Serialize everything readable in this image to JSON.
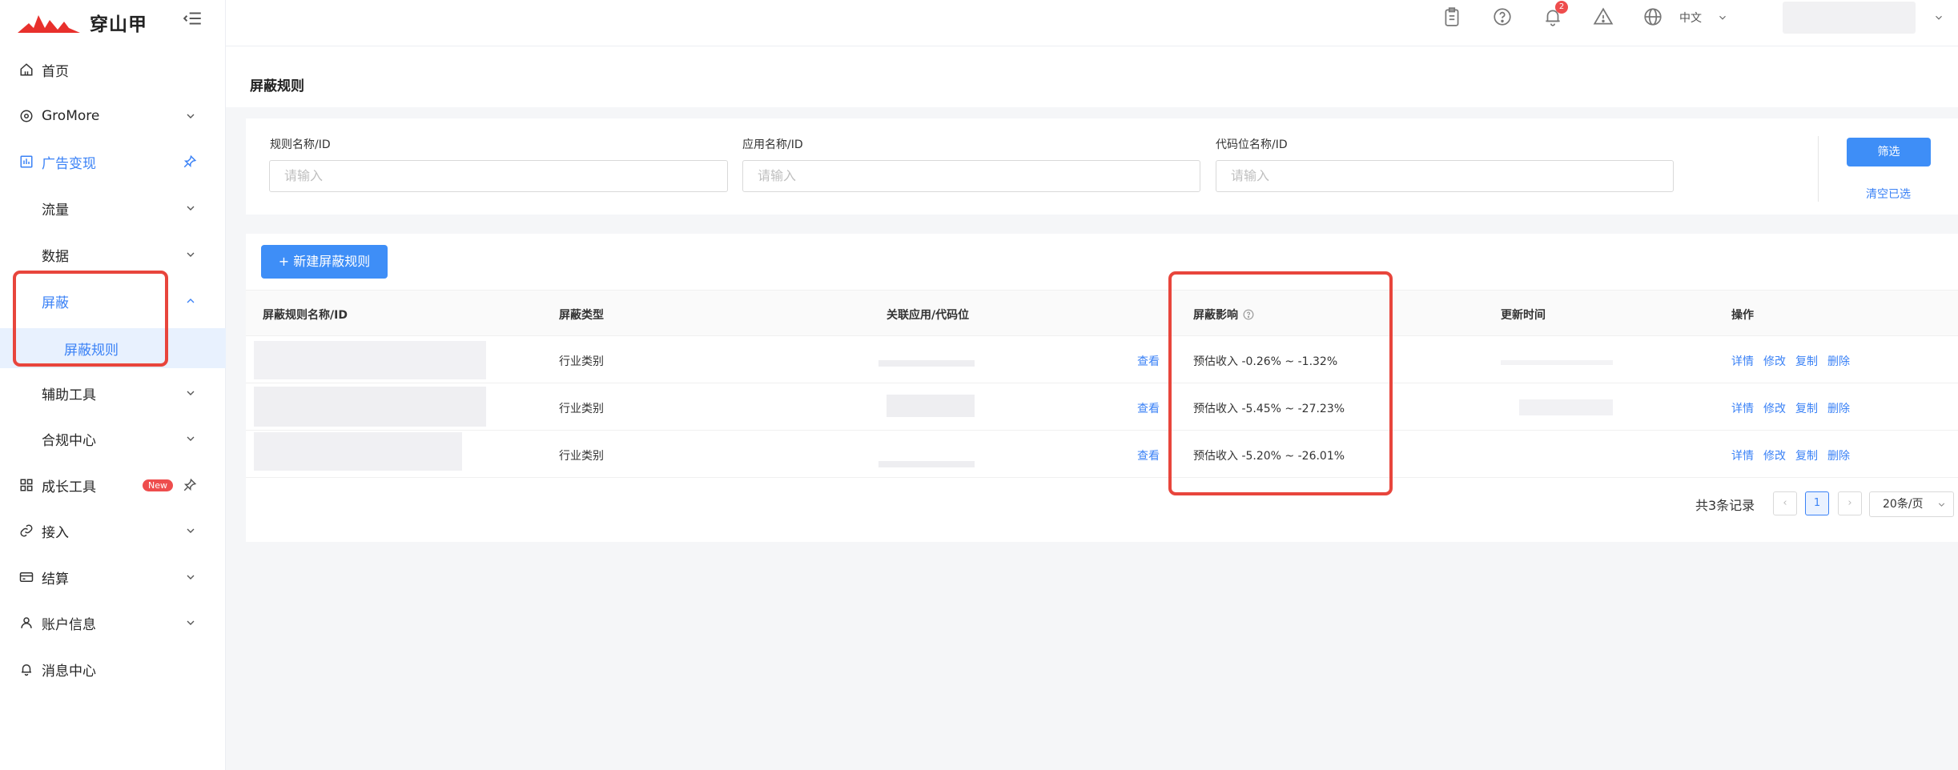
{
  "app": {
    "logo_text": "穿山甲"
  },
  "sidebar": {
    "items": [
      {
        "label": "首页",
        "icon": "home-icon"
      },
      {
        "label": "GroMore",
        "icon": "gromore-icon"
      },
      {
        "label": "广告变现",
        "icon": "chart-icon"
      },
      {
        "label": "流量"
      },
      {
        "label": "数据"
      },
      {
        "label": "屏蔽"
      },
      {
        "label": "屏蔽规则"
      },
      {
        "label": "辅助工具"
      },
      {
        "label": "合规中心"
      },
      {
        "label": "成长工具",
        "icon": "grid-icon",
        "badge": "New"
      },
      {
        "label": "接入",
        "icon": "link-icon"
      },
      {
        "label": "结算",
        "icon": "wallet-icon"
      },
      {
        "label": "账户信息",
        "icon": "user-icon"
      },
      {
        "label": "消息中心",
        "icon": "bell-icon"
      }
    ]
  },
  "topbar": {
    "notification_count": "2",
    "language": "中文"
  },
  "page": {
    "title": "屏蔽规则"
  },
  "filters": {
    "fields": [
      {
        "label": "规则名称/ID",
        "placeholder": "请输入"
      },
      {
        "label": "应用名称/ID",
        "placeholder": "请输入"
      },
      {
        "label": "代码位名称/ID",
        "placeholder": "请输入"
      }
    ],
    "filter_button": "筛选",
    "clear_link": "清空已选"
  },
  "table": {
    "new_button": "+ 新建屏蔽规则",
    "columns": [
      "屏蔽规则名称/ID",
      "屏蔽类型",
      "关联应用/代码位",
      "屏蔽影响",
      "更新时间",
      "操作"
    ],
    "rows": [
      {
        "type": "行业类别",
        "view": "查看",
        "impact": "预估收入 -0.26% ~ -1.32%",
        "actions": [
          "详情",
          "修改",
          "复制",
          "删除"
        ]
      },
      {
        "type": "行业类别",
        "view": "查看",
        "impact": "预估收入 -5.45% ~ -27.23%",
        "actions": [
          "详情",
          "修改",
          "复制",
          "删除"
        ]
      },
      {
        "type": "行业类别",
        "view": "查看",
        "impact": "预估收入 -5.20% ~ -26.01%",
        "actions": [
          "详情",
          "修改",
          "复制",
          "删除"
        ]
      }
    ]
  },
  "pagination": {
    "total": "共3条记录",
    "current_page": "1",
    "page_size": "20条/页"
  },
  "colors": {
    "accent": "#3e8ef7",
    "highlight_box": "#e8453c",
    "badge": "#ee4d4d"
  }
}
